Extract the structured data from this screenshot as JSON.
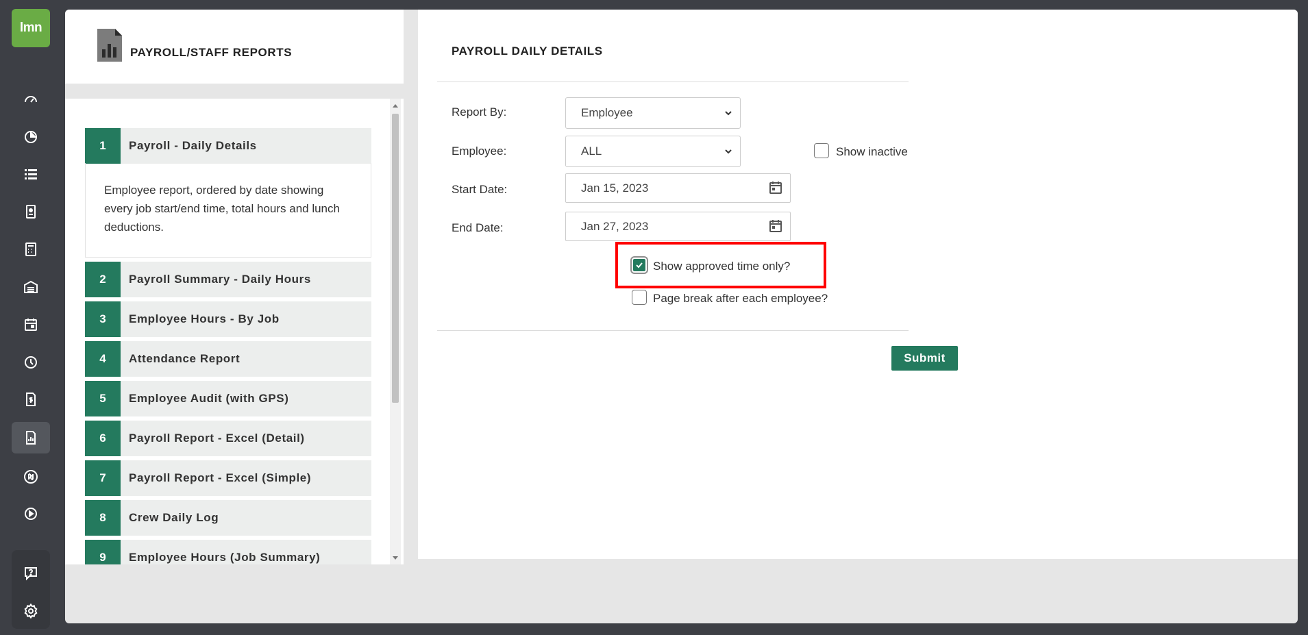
{
  "app": {
    "logo_text": "lmn",
    "rail_icons": [
      "dashboard-icon",
      "pie-chart-icon",
      "list-icon",
      "badge-icon",
      "calculator-icon",
      "warehouse-icon",
      "calendar-icon",
      "clock-icon",
      "invoice-icon",
      "reports-icon",
      "quickbooks-icon",
      "play-icon",
      "help-icon",
      "gear-icon"
    ],
    "active_rail_icon": "reports-icon"
  },
  "left_panel": {
    "title": "PAYROLL/STAFF REPORTS",
    "reports": [
      {
        "num": "1",
        "label": "Payroll - Daily Details",
        "description": "Employee report, ordered by date showing every job start/end time, total hours and lunch deductions."
      },
      {
        "num": "2",
        "label": "Payroll Summary - Daily Hours"
      },
      {
        "num": "3",
        "label": "Employee Hours - By Job"
      },
      {
        "num": "4",
        "label": "Attendance Report"
      },
      {
        "num": "5",
        "label": "Employee Audit (with GPS)"
      },
      {
        "num": "6",
        "label": "Payroll Report - Excel (Detail)"
      },
      {
        "num": "7",
        "label": "Payroll Report - Excel (Simple)"
      },
      {
        "num": "8",
        "label": "Crew Daily Log"
      },
      {
        "num": "9",
        "label": "Employee Hours (Job Summary)"
      }
    ]
  },
  "form": {
    "title": "PAYROLL DAILY DETAILS",
    "report_by": {
      "label": "Report By:",
      "value": "Employee"
    },
    "employee": {
      "label": "Employee:",
      "value": "ALL"
    },
    "show_inactive": {
      "label": "Show inactive",
      "checked": false
    },
    "start_date": {
      "label": "Start Date:",
      "value": "Jan 15, 2023"
    },
    "end_date": {
      "label": "End Date:",
      "value": "Jan 27, 2023"
    },
    "approved_only": {
      "label": "Show approved time only?",
      "checked": true
    },
    "page_break": {
      "label": "Page break after each employee?",
      "checked": false
    },
    "submit_label": "Submit"
  },
  "colors": {
    "accent": "#247a5e",
    "logo": "#6aac45",
    "rail": "#3d3f45",
    "highlight": "#ff0000"
  }
}
